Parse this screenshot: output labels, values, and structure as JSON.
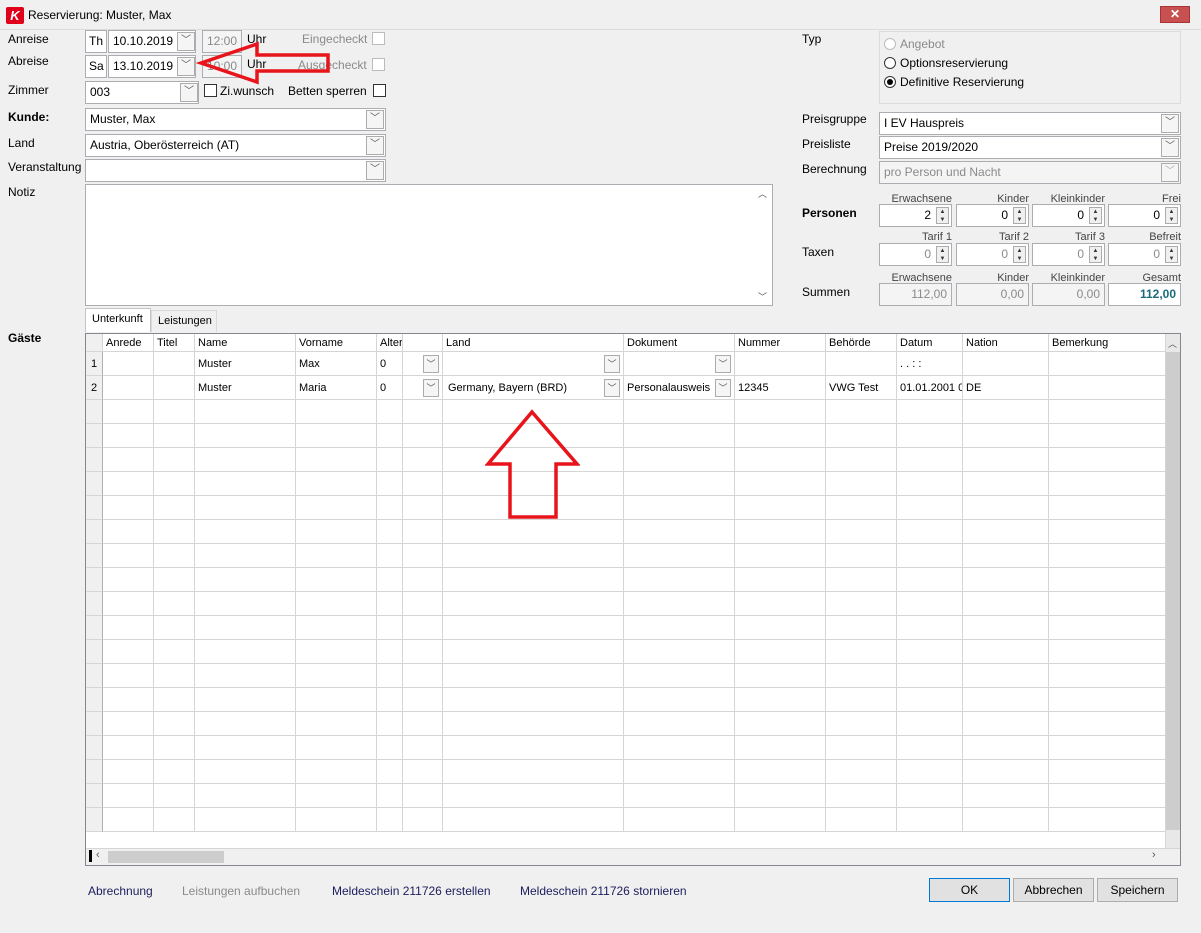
{
  "window": {
    "title": "Reservierung: Muster, Max",
    "app_icon": "K"
  },
  "dates": {
    "anreise_label": "Anreise",
    "anreise_day": "Th",
    "anreise_date": "10.10.2019",
    "anreise_time": "12:00",
    "abreise_label": "Abreise",
    "abreise_day": "Sa",
    "abreise_date": "13.10.2019",
    "abreise_time": "10:00",
    "uhr": "Uhr",
    "eingecheckt": "Eingecheckt",
    "ausgecheckt": "Ausgecheckt"
  },
  "zimmer": {
    "label": "Zimmer",
    "value": "003",
    "ziwunsch": "Zi.wunsch",
    "betten": "Betten sperren"
  },
  "kunde": {
    "label": "Kunde:",
    "value": "Muster, Max"
  },
  "land": {
    "label": "Land",
    "value": "Austria, Oberösterreich (AT)"
  },
  "veranstaltung": {
    "label": "Veranstaltung",
    "value": ""
  },
  "notiz": {
    "label": "Notiz",
    "value": ""
  },
  "typ": {
    "label": "Typ",
    "options": [
      "Angebot",
      "Optionsreservierung",
      "Definitive Reservierung"
    ],
    "selected": "Definitive Reservierung"
  },
  "preis": {
    "gruppe_label": "Preisgruppe",
    "gruppe_value": "I EV Hauspreis",
    "liste_label": "Preisliste",
    "liste_value": "Preise 2019/2020",
    "berechnung_label": "Berechnung",
    "berechnung_value": "pro Person und Nacht"
  },
  "personen": {
    "label": "Personen",
    "cols": [
      "Erwachsene",
      "Kinder",
      "Kleinkinder",
      "Frei"
    ],
    "values": [
      "2",
      "0",
      "0",
      "0"
    ]
  },
  "taxen": {
    "label": "Taxen",
    "cols": [
      "Tarif 1",
      "Tarif 2",
      "Tarif 3",
      "Befreit"
    ],
    "values": [
      "0",
      "0",
      "0",
      "0"
    ]
  },
  "summen": {
    "label": "Summen",
    "cols": [
      "Erwachsene",
      "Kinder",
      "Kleinkinder",
      "Gesamt"
    ],
    "values": [
      "112,00",
      "0,00",
      "0,00",
      "112,00"
    ]
  },
  "tabs": [
    "Unterkunft",
    "Leistungen"
  ],
  "gaeste": {
    "label": "Gäste",
    "columns": [
      "Anrede",
      "Titel",
      "Name",
      "Vorname",
      "Alter",
      "",
      "Land",
      "Dokument",
      "Nummer",
      "Behörde",
      "Datum",
      "Nation",
      "Bemerkung"
    ],
    "rows": [
      {
        "nr": "1",
        "anrede": "",
        "titel": "",
        "name": "Muster",
        "vorname": "Max",
        "alter": "0",
        "land": "",
        "dokument": "",
        "nummer": "",
        "behoerde": "",
        "datum": ".  .    :  :",
        "nation": "",
        "bemerkung": ""
      },
      {
        "nr": "2",
        "anrede": "",
        "titel": "",
        "name": "Muster",
        "vorname": "Maria",
        "alter": "0",
        "land": "Germany, Bayern (BRD)",
        "dokument": "Personalausweis",
        "nummer": "12345",
        "behoerde": "VWG Test",
        "datum": "01.01.2001 0",
        "nation": "DE",
        "bemerkung": ""
      }
    ]
  },
  "footer": {
    "abrechnung": "Abrechnung",
    "leistungen": "Leistungen aufbuchen",
    "melde_erstellen": "Meldeschein 211726 erstellen",
    "melde_stornieren": "Meldeschein 211726 stornieren",
    "ok": "OK",
    "abbrechen": "Abbrechen",
    "speichern": "Speichern"
  },
  "colors": {
    "annotation": "#e8141c",
    "total": "#1a6a7a",
    "accent": "#0078d7"
  }
}
